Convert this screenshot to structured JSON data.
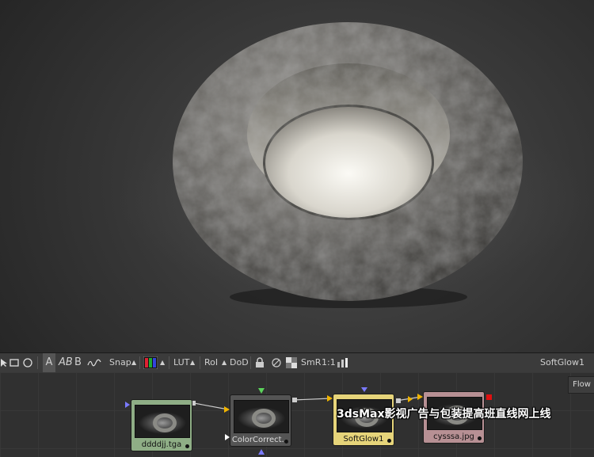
{
  "toolbar": {
    "text_a": "A",
    "text_ab": "AB",
    "text_b": "B",
    "snap_label": "Snap",
    "lut_label": "LUT",
    "roi_label": "RoI",
    "dod_label": "DoD",
    "smr_label": "SmR",
    "ratio_label": "1:1",
    "active_tool": "SoftGlow1",
    "icons": [
      "pointer-icon",
      "rectangle-icon",
      "ellipse-icon",
      "text-ab-icon",
      "scribble-icon",
      "color-channel-icon",
      "lock-icon",
      "link-icon",
      "checker-icon",
      "level-bars-icon"
    ]
  },
  "flow": {
    "tab_label": "Flow",
    "nodes": [
      {
        "label": "ddddjj.tga",
        "color": "#8fae86"
      },
      {
        "label": "ColorCorrect...",
        "color": "#545454"
      },
      {
        "label": "SoftGlow1",
        "color": "#e6d47a"
      },
      {
        "label": "cysssa.jpg",
        "color": "#b79094"
      }
    ]
  },
  "watermark": "3dsMax影视广告与包装提高班直线网上线"
}
